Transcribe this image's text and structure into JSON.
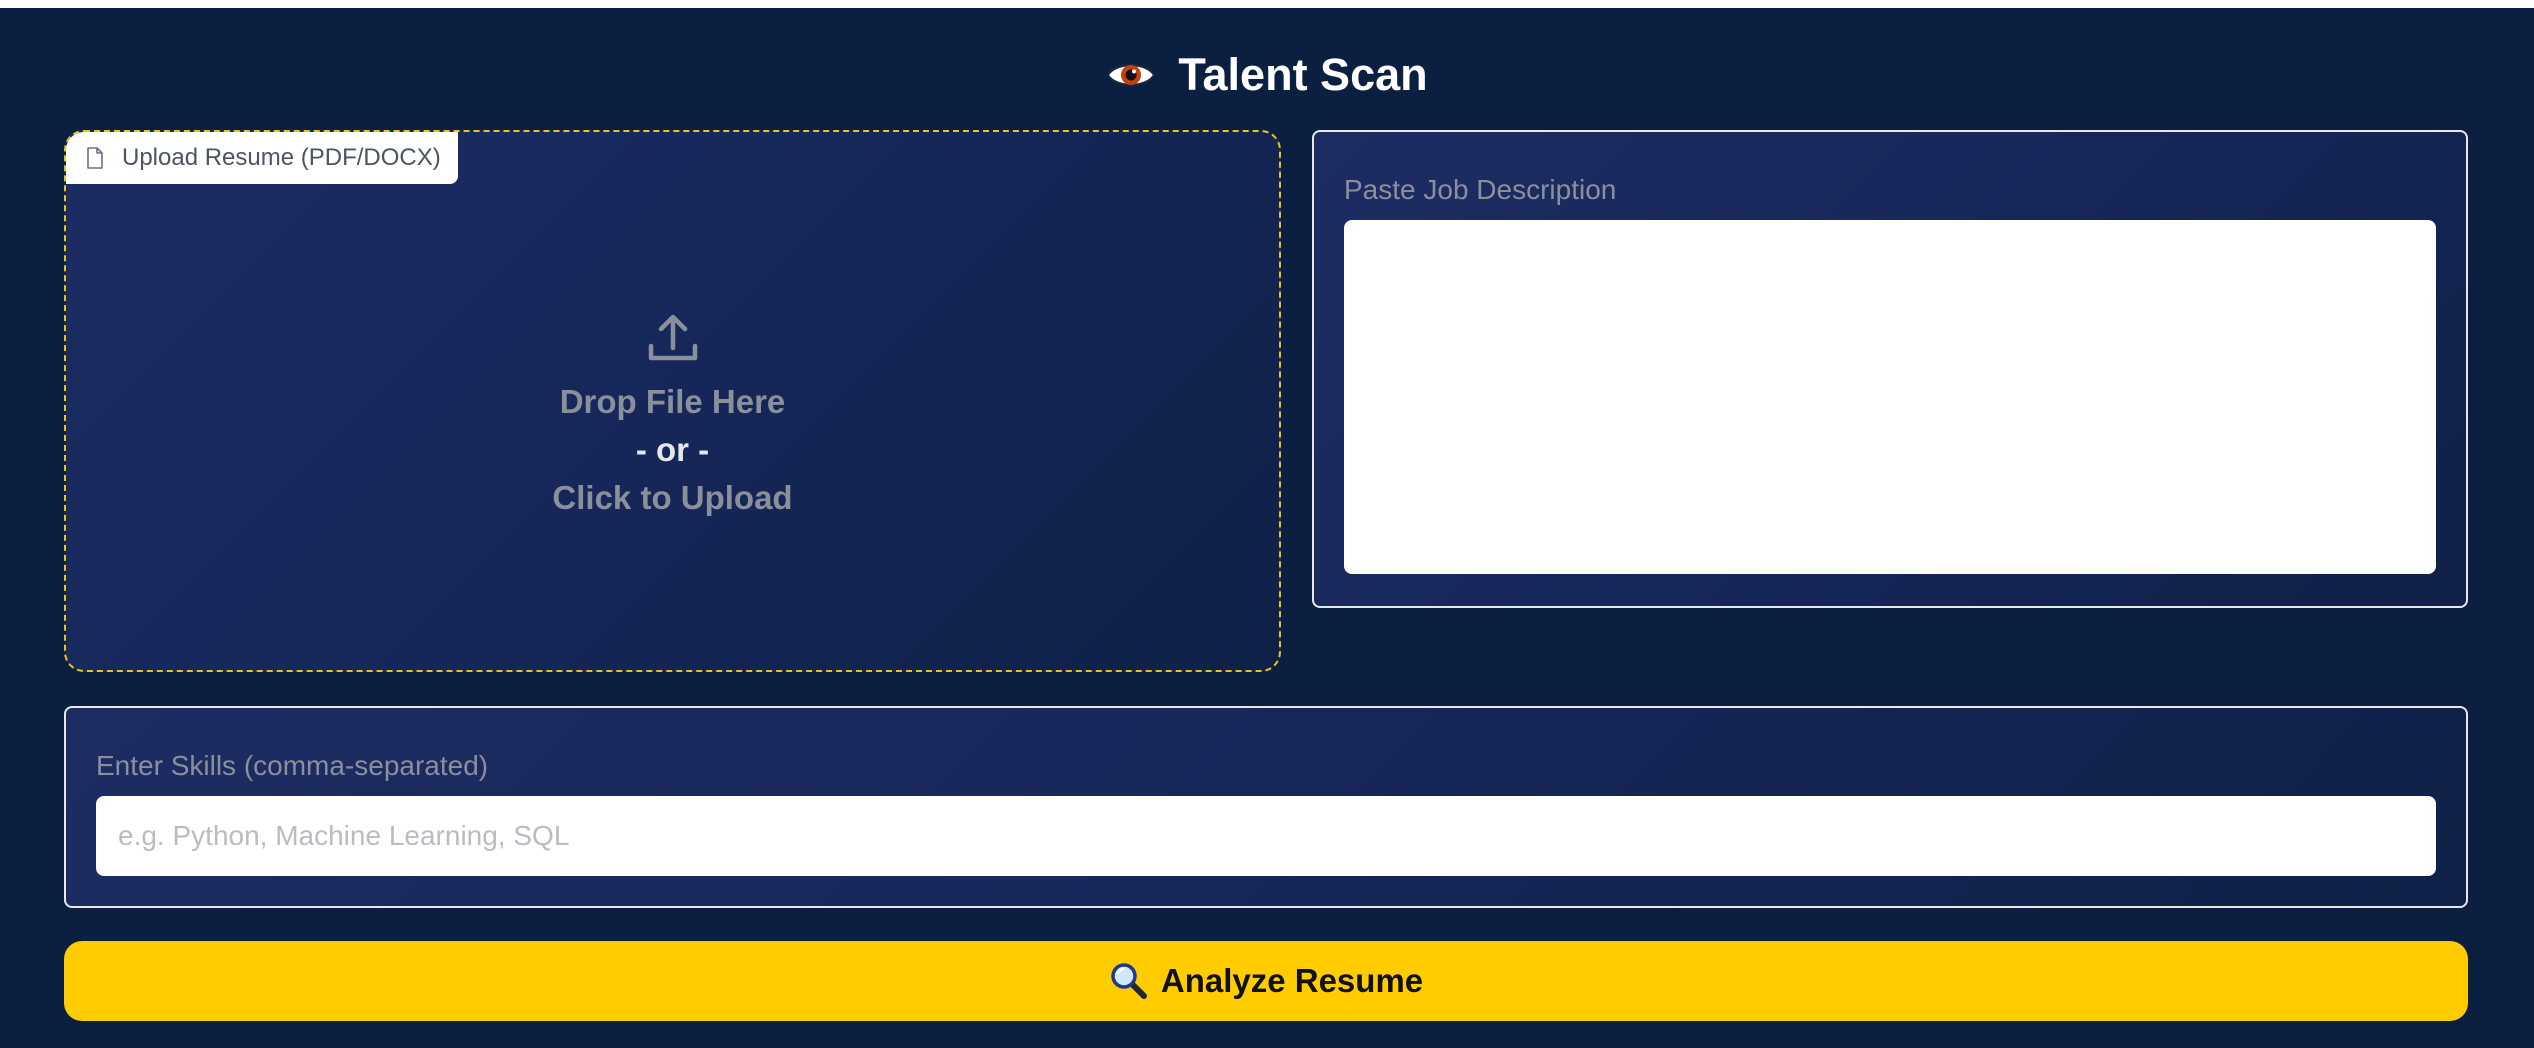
{
  "app": {
    "title": "Talent Scan",
    "title_icon": "eye-icon"
  },
  "upload": {
    "tag_label": "Upload Resume (PDF/DOCX)",
    "tag_icon": "file-icon",
    "upload_icon": "upload-icon",
    "drop_text": "Drop File Here",
    "or_text": "- or -",
    "click_text": "Click to Upload"
  },
  "job_description": {
    "label": "Paste Job Description",
    "value": ""
  },
  "skills": {
    "label": "Enter Skills (comma-separated)",
    "placeholder": "e.g. Python, Machine Learning, SQL",
    "value": ""
  },
  "analyze": {
    "label": "Analyze Resume",
    "icon": "magnifier-icon"
  },
  "colors": {
    "background": "#0b1f40",
    "accent": "#ffcc00",
    "dashed_border": "#e9c51a"
  }
}
